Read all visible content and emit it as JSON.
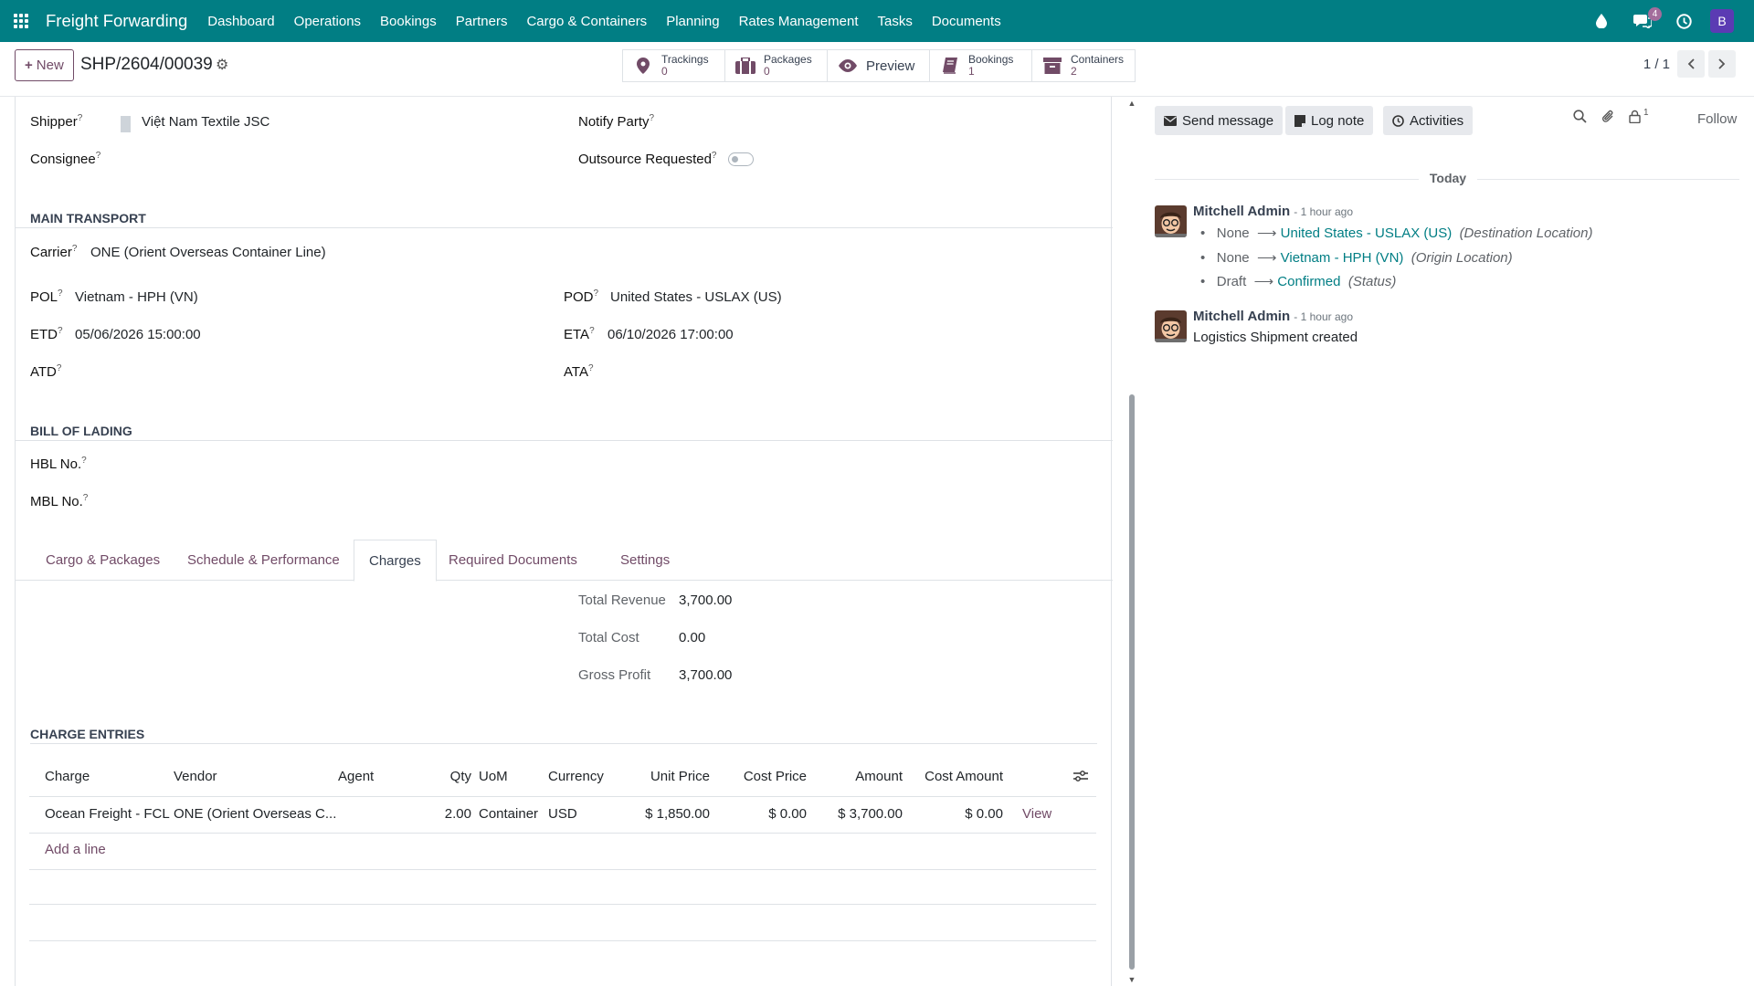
{
  "navbar": {
    "app_name": "Freight Forwarding",
    "menu": [
      "Dashboard",
      "Operations",
      "Bookings",
      "Partners",
      "Cargo & Containers",
      "Planning",
      "Rates Management",
      "Tasks",
      "Documents"
    ],
    "messages_badge": "4",
    "user_initial": "B"
  },
  "control": {
    "new_label": "New",
    "record_name": "SHP/2604/00039",
    "smart_buttons": [
      {
        "label": "Trackings",
        "count": "0"
      },
      {
        "label": "Packages",
        "count": "0"
      },
      {
        "label": "Preview"
      },
      {
        "label": "Bookings",
        "count": "1"
      },
      {
        "label": "Containers",
        "count": "2"
      }
    ],
    "pager": "1 / 1"
  },
  "form": {
    "shipper_label": "Shipper",
    "shipper_value": "Việt Nam Textile JSC",
    "notify_label": "Notify Party",
    "consignee_label": "Consignee",
    "outsource_label": "Outsource Requested",
    "outsource_value": false,
    "main_transport_title": "MAIN TRANSPORT",
    "carrier_label": "Carrier",
    "carrier_value": "ONE (Orient Overseas Container Line)",
    "pol_label": "POL",
    "pol_value": "Vietnam - HPH (VN)",
    "pod_label": "POD",
    "pod_value": "United States - USLAX (US)",
    "etd_label": "ETD",
    "etd_value": "05/06/2026 15:00:00",
    "eta_label": "ETA",
    "eta_value": "06/10/2026 17:00:00",
    "atd_label": "ATD",
    "ata_label": "ATA",
    "bol_title": "BILL OF LADING",
    "hbl_label": "HBL No.",
    "mbl_label": "MBL No.",
    "help_mark": "?"
  },
  "tabs": [
    {
      "label": "Cargo & Packages",
      "active": false
    },
    {
      "label": "Schedule & Performance",
      "active": false
    },
    {
      "label": "Charges",
      "active": true
    },
    {
      "label": "Required Documents",
      "active": false
    },
    {
      "label": "Settings",
      "active": false
    }
  ],
  "charges": {
    "total_revenue_label": "Total Revenue",
    "total_revenue": "3,700.00",
    "total_cost_label": "Total Cost",
    "total_cost": "0.00",
    "gross_profit_label": "Gross Profit",
    "gross_profit": "3,700.00",
    "entries_title": "CHARGE ENTRIES",
    "columns": [
      "Charge",
      "Vendor",
      "Agent",
      "Qty",
      "UoM",
      "Currency",
      "Unit Price",
      "Cost Price",
      "Amount",
      "Cost Amount"
    ],
    "rows": [
      {
        "charge": "Ocean Freight - FCL",
        "vendor": "ONE (Orient Overseas C...",
        "agent": "",
        "qty": "2.00",
        "uom": "Container",
        "currency": "USD",
        "unit_price": "$ 1,850.00",
        "cost_price": "$ 0.00",
        "amount": "$ 3,700.00",
        "cost_amount": "$ 0.00",
        "action": "View"
      }
    ],
    "add_line": "Add a line"
  },
  "chatter": {
    "send_message": "Send message",
    "log_note": "Log note",
    "activities": "Activities",
    "followers_count": "1",
    "follow": "Follow",
    "today": "Today",
    "messages": [
      {
        "author": "Mitchell Admin",
        "time": "- 1 hour ago",
        "tracking": [
          {
            "old": "None",
            "new": "United States - USLAX (US)",
            "field": "(Destination Location)"
          },
          {
            "old": "None",
            "new": "Vietnam - HPH (VN)",
            "field": "(Origin Location)"
          },
          {
            "old": "Draft",
            "new": "Confirmed",
            "field": "(Status)"
          }
        ]
      },
      {
        "author": "Mitchell Admin",
        "time": "- 1 hour ago",
        "body": "Logistics Shipment created"
      }
    ]
  },
  "colors": {
    "navbar": "#017e84",
    "primary": "#714b67",
    "link": "#017e84"
  }
}
